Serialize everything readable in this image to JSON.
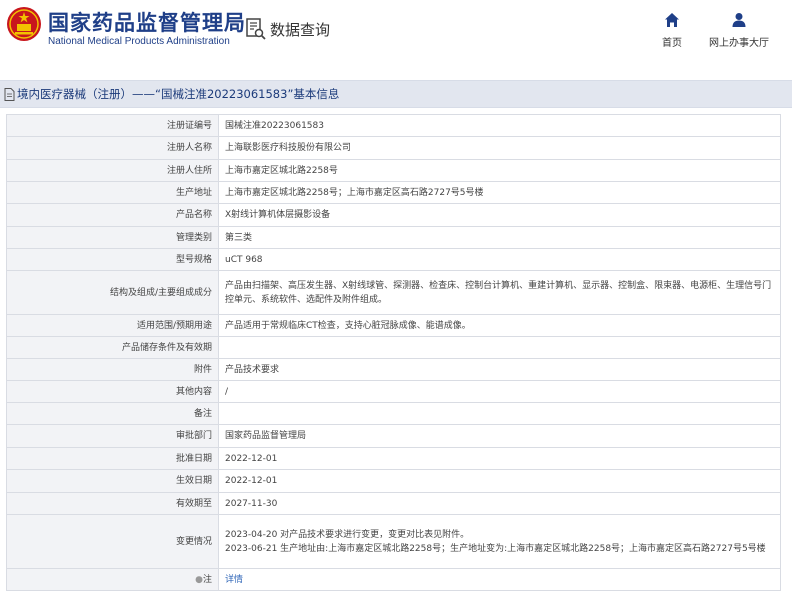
{
  "header": {
    "site_name_cn": "国家药品监督管理局",
    "site_name_en": "National Medical Products Administration",
    "query_label": "数据查询",
    "nav": {
      "home_label": "首页",
      "service_label": "网上办事大厅"
    }
  },
  "title": "境内医疗器械（注册）——“国械注准20223061583”基本信息",
  "rows": [
    {
      "label": "注册证编号",
      "value": "国械注准20223061583"
    },
    {
      "label": "注册人名称",
      "value": "上海联影医疗科技股份有限公司"
    },
    {
      "label": "注册人住所",
      "value": "上海市嘉定区城北路2258号"
    },
    {
      "label": "生产地址",
      "value": "上海市嘉定区城北路2258号；上海市嘉定区高石路2727号5号楼"
    },
    {
      "label": "产品名称",
      "value": "X射线计算机体层摄影设备"
    },
    {
      "label": "管理类别",
      "value": "第三类"
    },
    {
      "label": "型号规格",
      "value": "uCT 968"
    },
    {
      "label": "结构及组成/主要组成成分",
      "value": "产品由扫描架、高压发生器、X射线球管、探测器、检查床、控制台计算机、重建计算机、显示器、控制盒、限束器、电源柜、生理信号门控单元、系统软件、选配件及附件组成。"
    },
    {
      "label": "适用范围/预期用途",
      "value": "产品适用于常规临床CT检查，支持心脏冠脉成像、能谱成像。"
    },
    {
      "label": "产品储存条件及有效期",
      "value": ""
    },
    {
      "label": "附件",
      "value": "产品技术要求"
    },
    {
      "label": "其他内容",
      "value": "/"
    },
    {
      "label": "备注",
      "value": ""
    },
    {
      "label": "审批部门",
      "value": "国家药品监督管理局"
    },
    {
      "label": "批准日期",
      "value": "2022-12-01"
    },
    {
      "label": "生效日期",
      "value": "2022-12-01"
    },
    {
      "label": "有效期至",
      "value": "2027-11-30"
    },
    {
      "label": "变更情况",
      "value": "2023-04-20 对产品技术要求进行变更，变更对比表见附件。\n2023-06-21 生产地址由:上海市嘉定区城北路2258号；生产地址变为:上海市嘉定区城北路2258号；上海市嘉定区高石路2727号5号楼"
    }
  ],
  "note_row": {
    "label": "注",
    "link_text": "详情"
  },
  "colors": {
    "brand_blue": "#1f3f88",
    "title_bar_bg": "#e2e6ef",
    "label_bg": "#f2f3f6",
    "link": "#2f66b8"
  }
}
